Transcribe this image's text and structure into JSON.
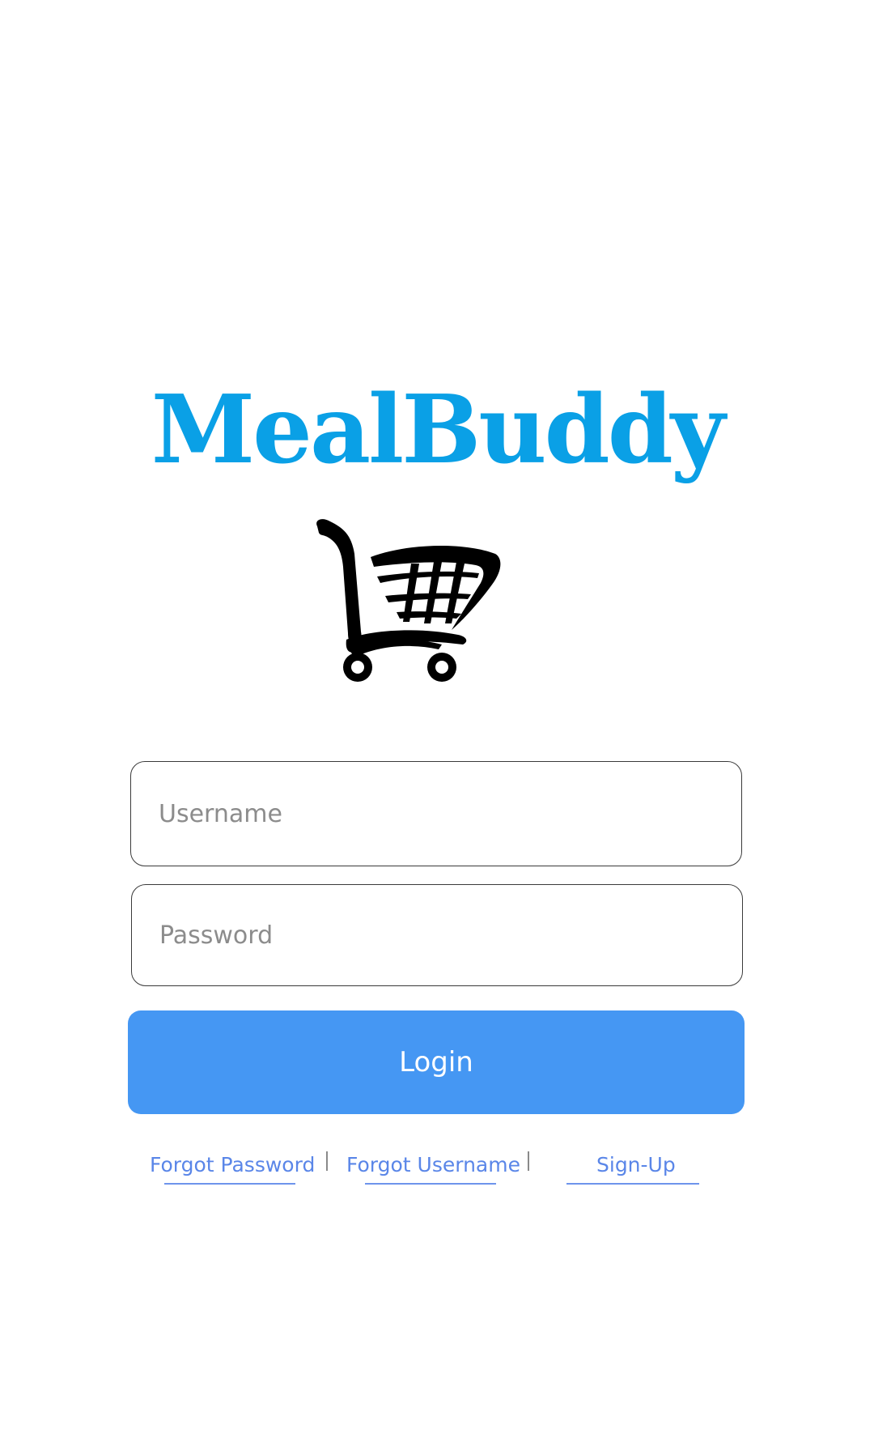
{
  "app": {
    "title": "MealBuddy",
    "logo_icon": "shopping-cart-icon",
    "brand_color": "#0aa0e6"
  },
  "form": {
    "username_placeholder": "Username",
    "username_value": "",
    "password_placeholder": "Password",
    "password_value": "",
    "login_label": "Login",
    "login_color": "#4597f3"
  },
  "links": {
    "forgot_password": "Forgot Password",
    "forgot_username": "Forgot Username",
    "sign_up": "Sign-Up",
    "link_color": "#5a86e8"
  }
}
